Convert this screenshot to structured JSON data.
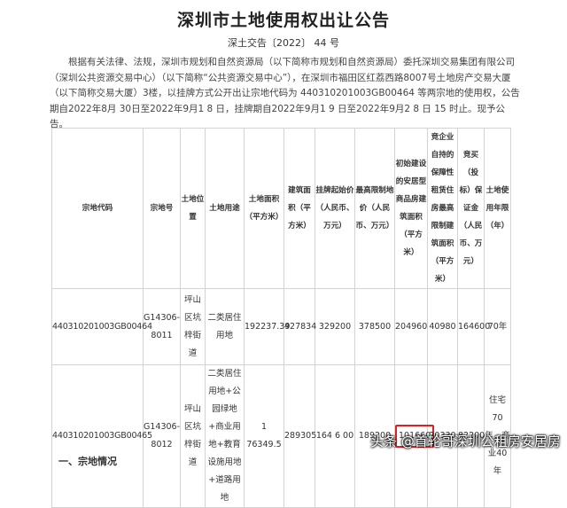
{
  "title": "深圳市土地使用权出让公告",
  "doc_no": "深土交告〔2022〕 44 号",
  "paragraph": "根据有关法律、法规，深圳市规划和自然资源局（以下简称市规划和自然资源局）委托深圳交易集团有限公司（深圳公共资源交易中心）（以下简称“公共资源交易中心”），在深圳市福田区红荔西路8007号土地房产交易大厦（以下简称交易大厦）3楼，以挂牌方式公开出让宗地代码为 440310201003GB00464 等两宗地的使用权，公告期自2022年8月 30日至2022年9月1 8 日，挂牌期自2022年9月1 9 日至2022年9月2 8 日 15 时止。现予公告。",
  "table": {
    "headers": [
      "宗地代码",
      "宗地号",
      "土地位置",
      "土地用途",
      "土地面积（平方米）",
      "建筑面积（平方米）",
      "挂牌起始价（人民币、万元）",
      "最高限制地价（人民币、万元）",
      "初始建设的安居型商品房建筑面积（平方米）",
      "竞企业自持的保障性租赁住房最高限制建筑面积（平方米）",
      "竞买（投标）保证金（人民币、万元）",
      "土地使用年限（年）"
    ],
    "rows": [
      {
        "code": "440310201003GB00464",
        "lot": "G14306-8011",
        "location": "坪山区坑梓街道",
        "use": "二类居住用地",
        "land_area": "192237.39",
        "floor_area": "427834",
        "start_price": "329200",
        "max_price": "378500",
        "housing_area": "204960",
        "rental_area": "40980",
        "deposit": "164600",
        "term": "70年"
      },
      {
        "code": "440310201003GB00465",
        "lot": "G14306-8012",
        "location": "坪山区坑梓街道",
        "use": "二类居住用地+公园绿地+商业用地+教育设施用地+道路用地",
        "land_area": "1 76349.5",
        "floor_area": "289305",
        "start_price": "164 6 00",
        "max_price": "189200",
        "housing_area": "101660",
        "rental_area": "20330",
        "deposit": "82200",
        "term": "住宅70年，商业40年"
      }
    ]
  },
  "section_heading": "一、宗地情况",
  "watermark": "头条 @首轮哥深圳公租房安居房",
  "highlight_color": "#e02020"
}
